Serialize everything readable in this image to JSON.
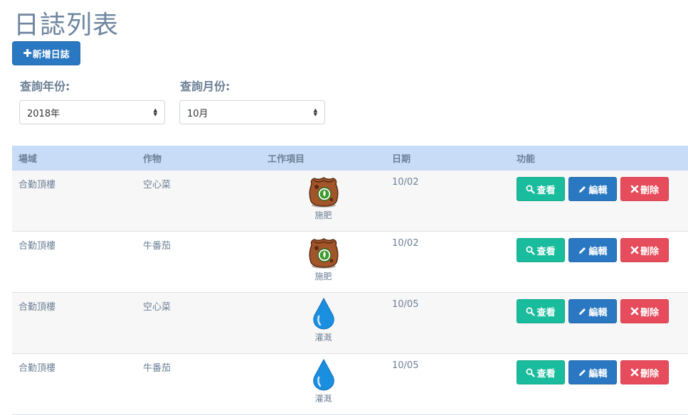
{
  "page": {
    "title": "日誌列表"
  },
  "toolbar": {
    "add_label": "新增日誌"
  },
  "filters": {
    "year_label": "查詢年份:",
    "year_value": "2018年",
    "month_label": "查詢月份:",
    "month_value": "10月"
  },
  "table": {
    "headers": [
      "場域",
      "作物",
      "工作項目",
      "日期",
      "功能"
    ],
    "actions": {
      "view": "查看",
      "edit": "編輯",
      "delete": "刪除"
    },
    "rows": [
      {
        "field": "合勤頂樓",
        "crop": "空心菜",
        "work": "施肥",
        "work_icon": "fertilizer-bag-icon",
        "date": "10/02"
      },
      {
        "field": "合勤頂樓",
        "crop": "牛番茄",
        "work": "施肥",
        "work_icon": "fertilizer-bag-icon",
        "date": "10/02"
      },
      {
        "field": "合勤頂樓",
        "crop": "空心菜",
        "work": "灌溉",
        "work_icon": "water-drop-icon",
        "date": "10/05"
      },
      {
        "field": "合勤頂樓",
        "crop": "牛番茄",
        "work": "灌溉",
        "work_icon": "water-drop-icon",
        "date": "10/05"
      }
    ]
  },
  "colors": {
    "primary": "#2a78c2",
    "success": "#19bc9c",
    "danger": "#e74c5c",
    "header_bg": "#c8dcf7"
  }
}
